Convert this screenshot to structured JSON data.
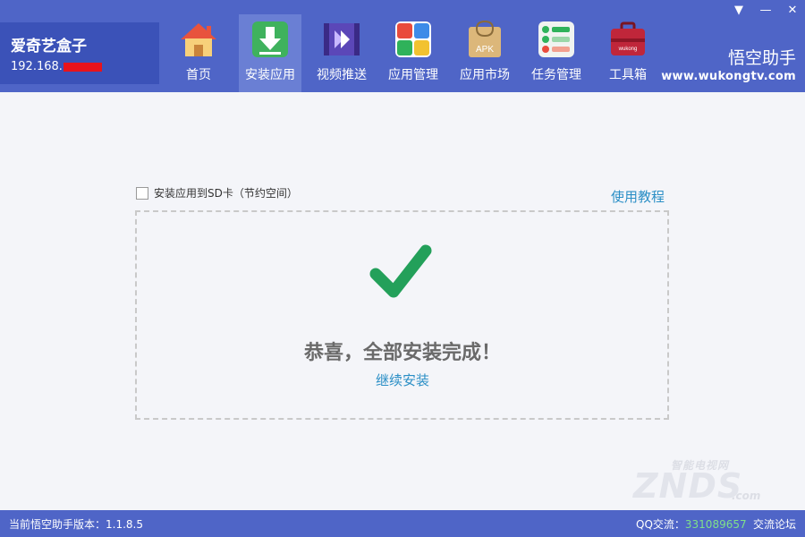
{
  "device": {
    "name": "爱奇艺盒子",
    "ip_prefix": "192.168."
  },
  "window_controls": {
    "menu": "▼",
    "minimize": "—",
    "close": "✕"
  },
  "nav": [
    {
      "label": "首页",
      "icon": "home-icon"
    },
    {
      "label": "安装应用",
      "icon": "install-download-icon",
      "active": true
    },
    {
      "label": "视频推送",
      "icon": "video-push-icon"
    },
    {
      "label": "应用管理",
      "icon": "app-manage-icon"
    },
    {
      "label": "应用市场",
      "icon": "apk-market-icon"
    },
    {
      "label": "任务管理",
      "icon": "task-manage-icon"
    },
    {
      "label": "工具箱",
      "icon": "toolbox-icon"
    }
  ],
  "brand": {
    "name": "悟空助手",
    "url": "www.wukongtv.com"
  },
  "icon_texts": {
    "apk": "APK",
    "toolbox": "wukong"
  },
  "main": {
    "sd_label": "安装应用到SD卡（节约空间）",
    "tutorial": "使用教程",
    "success": "恭喜，全部安装完成！",
    "continue": "继续安装"
  },
  "watermark": {
    "top": "智能电视网",
    "main": "ZNDS",
    "suffix": ".com"
  },
  "status": {
    "version": "当前悟空助手版本：1.1.8.5",
    "qq_label": "QQ交流：",
    "qq_number": "331089657",
    "forum": "交流论坛"
  },
  "colors": {
    "header": "#4f65c7",
    "accent": "#2b8fc6",
    "check": "#23a05a"
  }
}
